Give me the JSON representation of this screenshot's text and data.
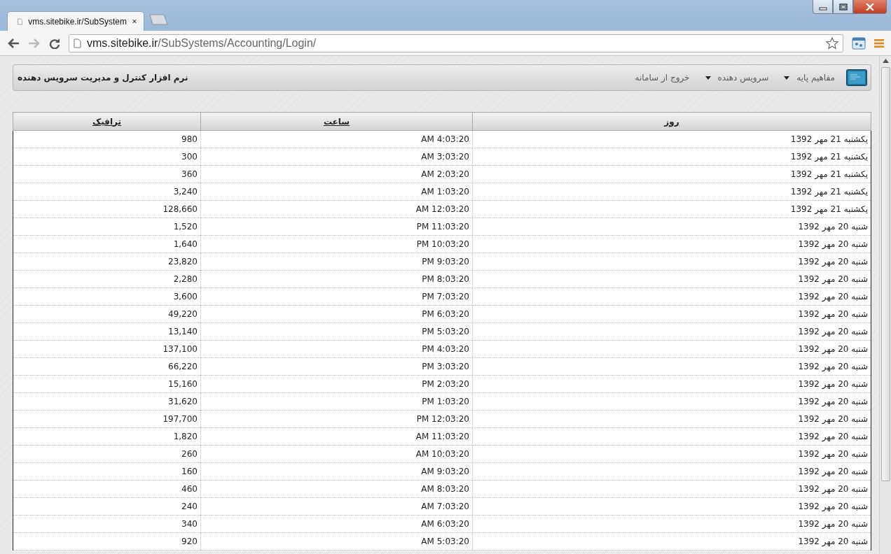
{
  "browser": {
    "tab_title": "vms.sitebike.ir/SubSystem",
    "url_host": "vms.sitebike.ir",
    "url_path": "/SubSystems/Accounting/Login/"
  },
  "header": {
    "menu": [
      {
        "label": "مفاهیم پایه",
        "kind": "dropdown"
      },
      {
        "label": "سرویس دهنده",
        "kind": "dropdown"
      },
      {
        "label": "خروج از سامانه",
        "kind": "link"
      }
    ],
    "title": "نرم افزار کنترل و مدیریت سرویس دهنده"
  },
  "table": {
    "columns": [
      "روز",
      "ساعت",
      "ترافیک"
    ],
    "rows": [
      [
        "یکشنبه 21 مهر 1392",
        "4:03:20 AM",
        "980"
      ],
      [
        "یکشنبه 21 مهر 1392",
        "3:03:20 AM",
        "300"
      ],
      [
        "یکشنبه 21 مهر 1392",
        "2:03:20 AM",
        "360"
      ],
      [
        "یکشنبه 21 مهر 1392",
        "1:03:20 AM",
        "3,240"
      ],
      [
        "یکشنبه 21 مهر 1392",
        "12:03:20 AM",
        "128,660"
      ],
      [
        "شنبه 20 مهر 1392",
        "11:03:20 PM",
        "1,520"
      ],
      [
        "شنبه 20 مهر 1392",
        "10:03:20 PM",
        "1,640"
      ],
      [
        "شنبه 20 مهر 1392",
        "9:03:20 PM",
        "23,820"
      ],
      [
        "شنبه 20 مهر 1392",
        "8:03:20 PM",
        "2,280"
      ],
      [
        "شنبه 20 مهر 1392",
        "7:03:20 PM",
        "3,600"
      ],
      [
        "شنبه 20 مهر 1392",
        "6:03:20 PM",
        "49,220"
      ],
      [
        "شنبه 20 مهر 1392",
        "5:03:20 PM",
        "13,140"
      ],
      [
        "شنبه 20 مهر 1392",
        "4:03:20 PM",
        "137,100"
      ],
      [
        "شنبه 20 مهر 1392",
        "3:03:20 PM",
        "66,220"
      ],
      [
        "شنبه 20 مهر 1392",
        "2:03:20 PM",
        "15,160"
      ],
      [
        "شنبه 20 مهر 1392",
        "1:03:20 PM",
        "31,620"
      ],
      [
        "شنبه 20 مهر 1392",
        "12:03:20 PM",
        "197,700"
      ],
      [
        "شنبه 20 مهر 1392",
        "11:03:20 AM",
        "1,820"
      ],
      [
        "شنبه 20 مهر 1392",
        "10:03:20 AM",
        "260"
      ],
      [
        "شنبه 20 مهر 1392",
        "9:03:20 AM",
        "160"
      ],
      [
        "شنبه 20 مهر 1392",
        "8:03:20 AM",
        "460"
      ],
      [
        "شنبه 20 مهر 1392",
        "7:03:20 AM",
        "240"
      ],
      [
        "شنبه 20 مهر 1392",
        "6:03:20 AM",
        "340"
      ],
      [
        "شنبه 20 مهر 1392",
        "5:03:20 AM",
        "920"
      ]
    ]
  }
}
